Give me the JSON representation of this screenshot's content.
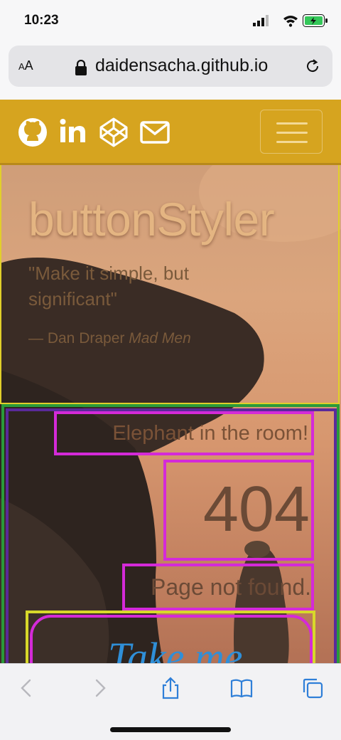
{
  "status": {
    "time": "10:23"
  },
  "browser": {
    "aa_small": "A",
    "aa_large": "A",
    "url": "daidensacha.github.io"
  },
  "header": {
    "title": "buttonStyler"
  },
  "quote": {
    "text": "\"Make it simple, but significant\"",
    "dash": "— Dan Draper ",
    "source": "Mad Men"
  },
  "error": {
    "heading": "Elephant in the room!",
    "code": "404",
    "message": "Page not found."
  },
  "cta": {
    "label": "Take me"
  },
  "colors": {
    "navbar": "#d6a41f",
    "cta_text": "#2f8fd8",
    "accent_outline": "#d42ad8"
  },
  "icons": [
    "github-icon",
    "linkedin-icon",
    "codepen-icon",
    "mail-icon",
    "hamburger-icon",
    "back-icon",
    "forward-icon",
    "share-icon",
    "bookmarks-icon",
    "tabs-icon"
  ]
}
